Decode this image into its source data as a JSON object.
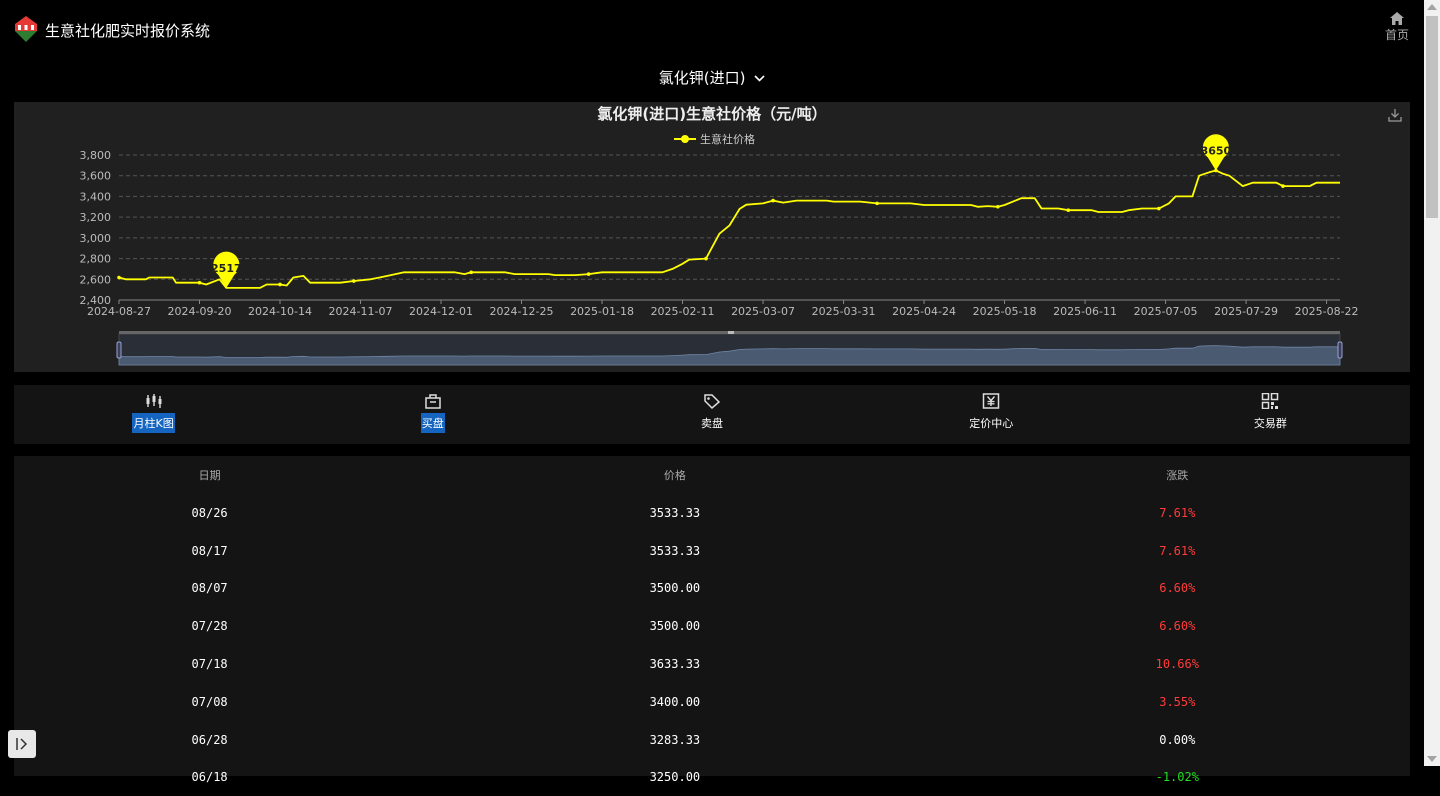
{
  "app": {
    "title": "生意社化肥实时报价系统",
    "home_label": "首页"
  },
  "product": {
    "selected": "氯化钾(进口)"
  },
  "chart_data": {
    "type": "line",
    "title": "氯化钾(进口)生意社价格（元/吨）",
    "legend": [
      "生意社价格"
    ],
    "ylim": [
      2400,
      3800
    ],
    "yticks": [
      2400,
      2600,
      2800,
      3000,
      3200,
      3400,
      3600,
      3800
    ],
    "xticks": [
      "2024-08-27",
      "2024-09-20",
      "2024-10-14",
      "2024-11-07",
      "2024-12-01",
      "2024-12-25",
      "2025-01-18",
      "2025-02-11",
      "2025-03-07",
      "2025-03-31",
      "2025-04-24",
      "2025-05-18",
      "2025-06-11",
      "2025-07-05",
      "2025-07-29",
      "2025-08-22"
    ],
    "x_start": "2024-08-27",
    "x_end": "2025-08-26",
    "grid": true,
    "legend_position": "top-center",
    "line_color": "#ffff00",
    "series": [
      {
        "name": "生意社价格",
        "points": [
          [
            "2024-08-27",
            2617
          ],
          [
            "2024-08-29",
            2600
          ],
          [
            "2024-09-04",
            2600
          ],
          [
            "2024-09-05",
            2617
          ],
          [
            "2024-09-12",
            2617
          ],
          [
            "2024-09-13",
            2567
          ],
          [
            "2024-09-20",
            2567
          ],
          [
            "2024-09-22",
            2550
          ],
          [
            "2024-09-26",
            2600
          ],
          [
            "2024-09-28",
            2517
          ],
          [
            "2024-10-08",
            2517
          ],
          [
            "2024-10-10",
            2550
          ],
          [
            "2024-10-14",
            2550
          ],
          [
            "2024-10-16",
            2540
          ],
          [
            "2024-10-18",
            2617
          ],
          [
            "2024-10-21",
            2633
          ],
          [
            "2024-10-23",
            2567
          ],
          [
            "2024-11-01",
            2567
          ],
          [
            "2024-11-05",
            2583
          ],
          [
            "2024-11-10",
            2600
          ],
          [
            "2024-11-15",
            2633
          ],
          [
            "2024-11-20",
            2667
          ],
          [
            "2024-12-05",
            2667
          ],
          [
            "2024-12-08",
            2650
          ],
          [
            "2024-12-10",
            2667
          ],
          [
            "2024-12-20",
            2667
          ],
          [
            "2024-12-23",
            2650
          ],
          [
            "2025-01-02",
            2650
          ],
          [
            "2025-01-04",
            2640
          ],
          [
            "2025-01-10",
            2640
          ],
          [
            "2025-01-14",
            2650
          ],
          [
            "2025-01-18",
            2667
          ],
          [
            "2025-02-05",
            2667
          ],
          [
            "2025-02-08",
            2700
          ],
          [
            "2025-02-11",
            2750
          ],
          [
            "2025-02-13",
            2790
          ],
          [
            "2025-02-18",
            2800
          ],
          [
            "2025-02-22",
            3040
          ],
          [
            "2025-02-25",
            3120
          ],
          [
            "2025-02-28",
            3280
          ],
          [
            "2025-03-02",
            3320
          ],
          [
            "2025-03-07",
            3333
          ],
          [
            "2025-03-10",
            3360
          ],
          [
            "2025-03-13",
            3340
          ],
          [
            "2025-03-17",
            3360
          ],
          [
            "2025-03-26",
            3360
          ],
          [
            "2025-03-28",
            3350
          ],
          [
            "2025-04-05",
            3350
          ],
          [
            "2025-04-10",
            3333
          ],
          [
            "2025-04-20",
            3333
          ],
          [
            "2025-04-24",
            3317
          ],
          [
            "2025-05-08",
            3317
          ],
          [
            "2025-05-10",
            3300
          ],
          [
            "2025-05-13",
            3307
          ],
          [
            "2025-05-16",
            3300
          ],
          [
            "2025-05-18",
            3317
          ],
          [
            "2025-05-23",
            3383
          ],
          [
            "2025-05-27",
            3383
          ],
          [
            "2025-05-29",
            3283
          ],
          [
            "2025-06-03",
            3283
          ],
          [
            "2025-06-06",
            3267
          ],
          [
            "2025-06-13",
            3267
          ],
          [
            "2025-06-15",
            3250
          ],
          [
            "2025-06-22",
            3250
          ],
          [
            "2025-06-24",
            3267
          ],
          [
            "2025-06-28",
            3283
          ],
          [
            "2025-07-03",
            3283
          ],
          [
            "2025-07-06",
            3333
          ],
          [
            "2025-07-08",
            3400
          ],
          [
            "2025-07-13",
            3400
          ],
          [
            "2025-07-15",
            3600
          ],
          [
            "2025-07-18",
            3633
          ],
          [
            "2025-07-20",
            3650
          ],
          [
            "2025-07-22",
            3620
          ],
          [
            "2025-07-24",
            3600
          ],
          [
            "2025-07-28",
            3500
          ],
          [
            "2025-07-31",
            3533
          ],
          [
            "2025-08-07",
            3533
          ],
          [
            "2025-08-09",
            3500
          ],
          [
            "2025-08-17",
            3500
          ],
          [
            "2025-08-19",
            3533
          ],
          [
            "2025-08-26",
            3533
          ]
        ]
      }
    ],
    "annotations": [
      {
        "label": "2517",
        "x": "2024-09-28",
        "y": 2517,
        "kind": "min"
      },
      {
        "label": "3650",
        "x": "2025-07-20",
        "y": 3650,
        "kind": "max"
      }
    ]
  },
  "nav": [
    {
      "label": "月柱K图",
      "icon": "candlestick-icon",
      "highlighted": true
    },
    {
      "label": "买盘",
      "icon": "basket-icon",
      "highlighted": true
    },
    {
      "label": "卖盘",
      "icon": "tag-icon",
      "highlighted": false
    },
    {
      "label": "定价中心",
      "icon": "yen-icon",
      "highlighted": false
    },
    {
      "label": "交易群",
      "icon": "qrcode-icon",
      "highlighted": false
    }
  ],
  "table": {
    "headers": [
      "日期",
      "价格",
      "涨跌"
    ],
    "rows": [
      {
        "date": "08/26",
        "price": "3533.33",
        "change": "7.61%",
        "trend": "up"
      },
      {
        "date": "08/17",
        "price": "3533.33",
        "change": "7.61%",
        "trend": "up"
      },
      {
        "date": "08/07",
        "price": "3500.00",
        "change": "6.60%",
        "trend": "up"
      },
      {
        "date": "07/28",
        "price": "3500.00",
        "change": "6.60%",
        "trend": "up"
      },
      {
        "date": "07/18",
        "price": "3633.33",
        "change": "10.66%",
        "trend": "up"
      },
      {
        "date": "07/08",
        "price": "3400.00",
        "change": "3.55%",
        "trend": "up"
      },
      {
        "date": "06/28",
        "price": "3283.33",
        "change": "0.00%",
        "trend": "flat"
      },
      {
        "date": "06/18",
        "price": "3250.00",
        "change": "-1.02%",
        "trend": "down"
      }
    ]
  },
  "colors": {
    "up": "#ff3b3b",
    "down": "#22dd22",
    "accent": "#1565c0",
    "line": "#ffff00"
  }
}
